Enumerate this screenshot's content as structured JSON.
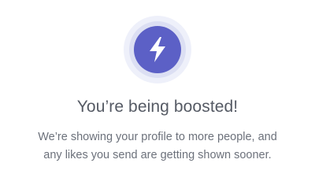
{
  "boost": {
    "icon": "lightning-bolt-icon",
    "title": "You’re being boosted!",
    "description_line1": "We’re showing your profile to more people, and",
    "description_line2": "any likes you send are getting shown sooner."
  },
  "colors": {
    "accent": "#5c60c6",
    "ring_inner": "#dcdff3",
    "ring_outer": "#eef0fa",
    "title_text": "#555a64",
    "body_text": "#6c717b",
    "background": "#ffffff"
  }
}
